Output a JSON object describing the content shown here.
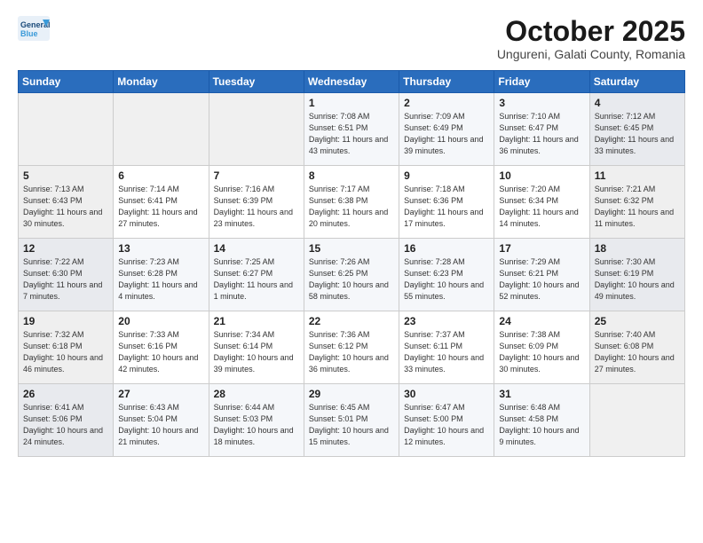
{
  "logo": {
    "line1": "General",
    "line2": "Blue"
  },
  "title": "October 2025",
  "location": "Ungureni, Galati County, Romania",
  "days_of_week": [
    "Sunday",
    "Monday",
    "Tuesday",
    "Wednesday",
    "Thursday",
    "Friday",
    "Saturday"
  ],
  "weeks": [
    [
      {
        "day": "",
        "info": ""
      },
      {
        "day": "",
        "info": ""
      },
      {
        "day": "",
        "info": ""
      },
      {
        "day": "1",
        "info": "Sunrise: 7:08 AM\nSunset: 6:51 PM\nDaylight: 11 hours\nand 43 minutes."
      },
      {
        "day": "2",
        "info": "Sunrise: 7:09 AM\nSunset: 6:49 PM\nDaylight: 11 hours\nand 39 minutes."
      },
      {
        "day": "3",
        "info": "Sunrise: 7:10 AM\nSunset: 6:47 PM\nDaylight: 11 hours\nand 36 minutes."
      },
      {
        "day": "4",
        "info": "Sunrise: 7:12 AM\nSunset: 6:45 PM\nDaylight: 11 hours\nand 33 minutes."
      }
    ],
    [
      {
        "day": "5",
        "info": "Sunrise: 7:13 AM\nSunset: 6:43 PM\nDaylight: 11 hours\nand 30 minutes."
      },
      {
        "day": "6",
        "info": "Sunrise: 7:14 AM\nSunset: 6:41 PM\nDaylight: 11 hours\nand 27 minutes."
      },
      {
        "day": "7",
        "info": "Sunrise: 7:16 AM\nSunset: 6:39 PM\nDaylight: 11 hours\nand 23 minutes."
      },
      {
        "day": "8",
        "info": "Sunrise: 7:17 AM\nSunset: 6:38 PM\nDaylight: 11 hours\nand 20 minutes."
      },
      {
        "day": "9",
        "info": "Sunrise: 7:18 AM\nSunset: 6:36 PM\nDaylight: 11 hours\nand 17 minutes."
      },
      {
        "day": "10",
        "info": "Sunrise: 7:20 AM\nSunset: 6:34 PM\nDaylight: 11 hours\nand 14 minutes."
      },
      {
        "day": "11",
        "info": "Sunrise: 7:21 AM\nSunset: 6:32 PM\nDaylight: 11 hours\nand 11 minutes."
      }
    ],
    [
      {
        "day": "12",
        "info": "Sunrise: 7:22 AM\nSunset: 6:30 PM\nDaylight: 11 hours\nand 7 minutes."
      },
      {
        "day": "13",
        "info": "Sunrise: 7:23 AM\nSunset: 6:28 PM\nDaylight: 11 hours\nand 4 minutes."
      },
      {
        "day": "14",
        "info": "Sunrise: 7:25 AM\nSunset: 6:27 PM\nDaylight: 11 hours\nand 1 minute."
      },
      {
        "day": "15",
        "info": "Sunrise: 7:26 AM\nSunset: 6:25 PM\nDaylight: 10 hours\nand 58 minutes."
      },
      {
        "day": "16",
        "info": "Sunrise: 7:28 AM\nSunset: 6:23 PM\nDaylight: 10 hours\nand 55 minutes."
      },
      {
        "day": "17",
        "info": "Sunrise: 7:29 AM\nSunset: 6:21 PM\nDaylight: 10 hours\nand 52 minutes."
      },
      {
        "day": "18",
        "info": "Sunrise: 7:30 AM\nSunset: 6:19 PM\nDaylight: 10 hours\nand 49 minutes."
      }
    ],
    [
      {
        "day": "19",
        "info": "Sunrise: 7:32 AM\nSunset: 6:18 PM\nDaylight: 10 hours\nand 46 minutes."
      },
      {
        "day": "20",
        "info": "Sunrise: 7:33 AM\nSunset: 6:16 PM\nDaylight: 10 hours\nand 42 minutes."
      },
      {
        "day": "21",
        "info": "Sunrise: 7:34 AM\nSunset: 6:14 PM\nDaylight: 10 hours\nand 39 minutes."
      },
      {
        "day": "22",
        "info": "Sunrise: 7:36 AM\nSunset: 6:12 PM\nDaylight: 10 hours\nand 36 minutes."
      },
      {
        "day": "23",
        "info": "Sunrise: 7:37 AM\nSunset: 6:11 PM\nDaylight: 10 hours\nand 33 minutes."
      },
      {
        "day": "24",
        "info": "Sunrise: 7:38 AM\nSunset: 6:09 PM\nDaylight: 10 hours\nand 30 minutes."
      },
      {
        "day": "25",
        "info": "Sunrise: 7:40 AM\nSunset: 6:08 PM\nDaylight: 10 hours\nand 27 minutes."
      }
    ],
    [
      {
        "day": "26",
        "info": "Sunrise: 6:41 AM\nSunset: 5:06 PM\nDaylight: 10 hours\nand 24 minutes."
      },
      {
        "day": "27",
        "info": "Sunrise: 6:43 AM\nSunset: 5:04 PM\nDaylight: 10 hours\nand 21 minutes."
      },
      {
        "day": "28",
        "info": "Sunrise: 6:44 AM\nSunset: 5:03 PM\nDaylight: 10 hours\nand 18 minutes."
      },
      {
        "day": "29",
        "info": "Sunrise: 6:45 AM\nSunset: 5:01 PM\nDaylight: 10 hours\nand 15 minutes."
      },
      {
        "day": "30",
        "info": "Sunrise: 6:47 AM\nSunset: 5:00 PM\nDaylight: 10 hours\nand 12 minutes."
      },
      {
        "day": "31",
        "info": "Sunrise: 6:48 AM\nSunset: 4:58 PM\nDaylight: 10 hours\nand 9 minutes."
      },
      {
        "day": "",
        "info": ""
      }
    ]
  ]
}
